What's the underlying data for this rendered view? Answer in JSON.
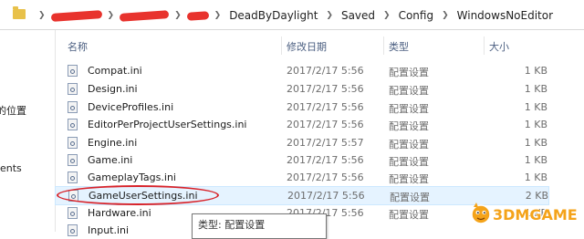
{
  "breadcrumbs": {
    "items": [
      "DeadByDaylight",
      "Saved",
      "Config",
      "WindowsNoEditor"
    ]
  },
  "leftnav": {
    "items": [
      "的位置",
      "ents"
    ]
  },
  "columns": {
    "name": "名称",
    "date": "修改日期",
    "type": "类型",
    "size": "大小"
  },
  "files": [
    {
      "name": "Compat.ini",
      "date": "2017/2/17 5:56",
      "type": "配置设置",
      "size": "1 KB"
    },
    {
      "name": "Design.ini",
      "date": "2017/2/17 5:56",
      "type": "配置设置",
      "size": "1 KB"
    },
    {
      "name": "DeviceProfiles.ini",
      "date": "2017/2/17 5:56",
      "type": "配置设置",
      "size": "1 KB"
    },
    {
      "name": "EditorPerProjectUserSettings.ini",
      "date": "2017/2/17 5:56",
      "type": "配置设置",
      "size": "1 KB"
    },
    {
      "name": "Engine.ini",
      "date": "2017/2/17 5:57",
      "type": "配置设置",
      "size": "1 KB"
    },
    {
      "name": "Game.ini",
      "date": "2017/2/17 5:56",
      "type": "配置设置",
      "size": "1 KB"
    },
    {
      "name": "GameplayTags.ini",
      "date": "2017/2/17 5:56",
      "type": "配置设置",
      "size": "1 KB"
    },
    {
      "name": "GameUserSettings.ini",
      "date": "2017/2/17 5:56",
      "type": "配置设置",
      "size": "2 KB"
    },
    {
      "name": "Hardware.ini",
      "date": "2017/2/17 5:56",
      "type": "配置设置",
      "size": "1 KB"
    },
    {
      "name": "Input.ini",
      "date": "",
      "type": "",
      "size": ""
    }
  ],
  "tooltip": {
    "text": "类型: 配置设置"
  },
  "watermark": {
    "text": "3DMGAME"
  },
  "colors": {
    "selection": "#e5f3ff",
    "annotation": "#d8232a",
    "header_text": "#4d6082"
  },
  "icons": {
    "folder": "folder-icon",
    "file": "config-file-icon"
  }
}
